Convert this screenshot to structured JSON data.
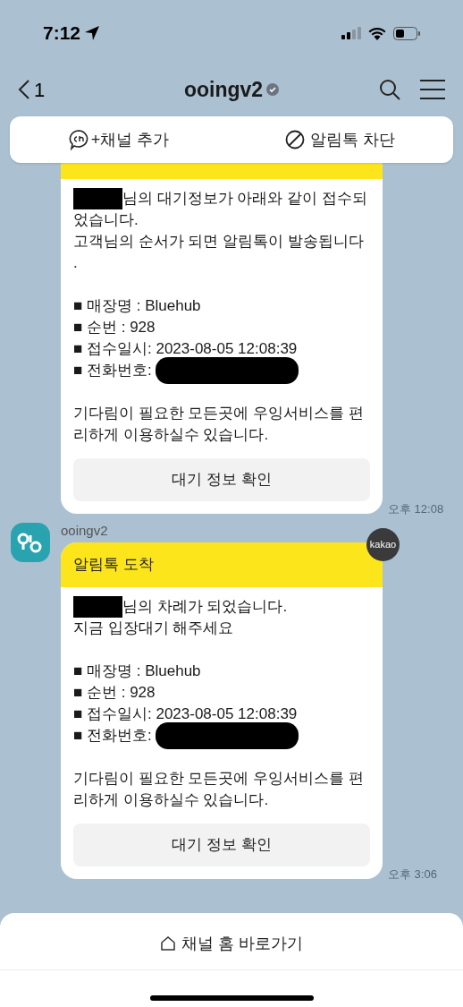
{
  "status_bar": {
    "time": "7:12"
  },
  "nav": {
    "back_count": "1",
    "title": "ooingv2",
    "verified": true
  },
  "actions": [
    {
      "kind": "channel",
      "label": "+채널 추가"
    },
    {
      "kind": "block",
      "label": "알림톡 차단"
    }
  ],
  "messages": [
    {
      "paragraphs": [
        [
          {
            "text": "님의 대기정보가 아래와 같이 접수되",
            "redacted_start": true
          },
          {
            "text": "었습니다."
          },
          {
            "text": "고객님의 순서가 되면 알림톡이 발송됩니다"
          },
          {
            "text": "."
          }
        ],
        [
          {
            "text": "■ 매장명 : Bluehub"
          },
          {
            "text": "■ 순번 : 928"
          },
          {
            "text": "■ 접수일시: 2023-08-05 12:08:39"
          },
          {
            "text": "■ 전화번호:",
            "redacted_end": true
          }
        ],
        [
          {
            "text": "기다림이 필요한 모든곳에 우잉서비스를 편"
          },
          {
            "text": "리하게 이용하실수 있습니다."
          }
        ]
      ],
      "button": "대기 정보 확인",
      "time": "오후 12:08"
    },
    {
      "sender": "ooingv2",
      "badge": "kakao",
      "header": "알림톡 도착",
      "paragraphs": [
        [
          {
            "text": "님의 차례가 되었습니다.",
            "redacted_start": true
          },
          {
            "text": "지금 입장대기 해주세요"
          }
        ],
        [
          {
            "text": "■ 매장명 : Bluehub"
          },
          {
            "text": "■ 순번 : 928"
          },
          {
            "text": "■ 접수일시: 2023-08-05 12:08:39"
          },
          {
            "text": "■ 전화번호:",
            "redacted_end": true
          }
        ],
        [
          {
            "text": "기다림이 필요한 모든곳에 우잉서비스를 편"
          },
          {
            "text": "리하게 이용하실수 있습니다."
          }
        ]
      ],
      "button": "대기 정보 확인",
      "time": "오후 3:06"
    }
  ],
  "bottom_bar": {
    "label": "채널 홈 바로가기"
  }
}
